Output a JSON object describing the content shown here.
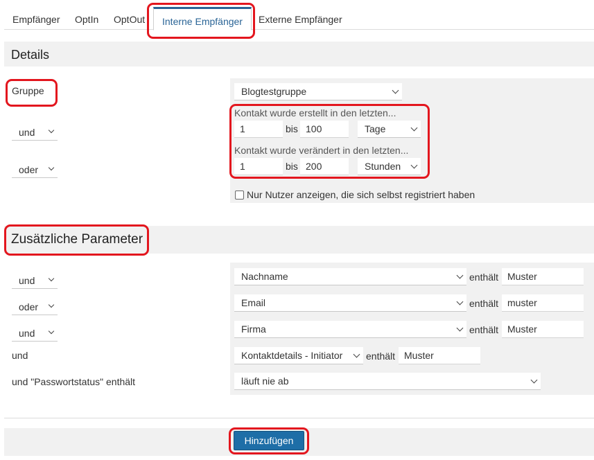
{
  "tabs": [
    "Empfänger",
    "OptIn",
    "OptOut",
    "Interne Empfänger",
    "Externe Empfänger"
  ],
  "details": {
    "title": "Details",
    "group_label": "Gruppe",
    "group_value": "Blogtestgruppe",
    "op1": "und",
    "op2": "oder",
    "created_hint": "Kontakt wurde erstellt in den letzten...",
    "created_from": "1",
    "created_bis": "bis",
    "created_to": "100",
    "created_unit": "Tage",
    "changed_hint": "Kontakt wurde verändert in den letzten...",
    "changed_from": "1",
    "changed_bis": "bis",
    "changed_to": "200",
    "changed_unit": "Stunden",
    "self_registered_label": "Nur Nutzer anzeigen, die sich selbst registriert haben"
  },
  "params": {
    "title": "Zusätzliche Parameter",
    "rows": [
      {
        "op": "und",
        "field": "Nachname",
        "cond": "enthält",
        "value": "Muster"
      },
      {
        "op": "oder",
        "field": "Email",
        "cond": "enthält",
        "value": "muster"
      },
      {
        "op": "und",
        "field": "Firma",
        "cond": "enthält",
        "value": "Muster"
      }
    ],
    "row4_op": "und",
    "row4_field": "Kontaktdetails - Initiator",
    "row4_cond": "enthält",
    "row4_value": "Muster",
    "row5_label": "und \"Passwortstatus\" enthält",
    "row5_value": "läuft nie ab"
  },
  "actions": {
    "add_label": "Hinzufügen"
  },
  "colors": {
    "accent": "#1e6ea7",
    "annotation": "#e3161e",
    "panel": "#f1f1f1"
  }
}
